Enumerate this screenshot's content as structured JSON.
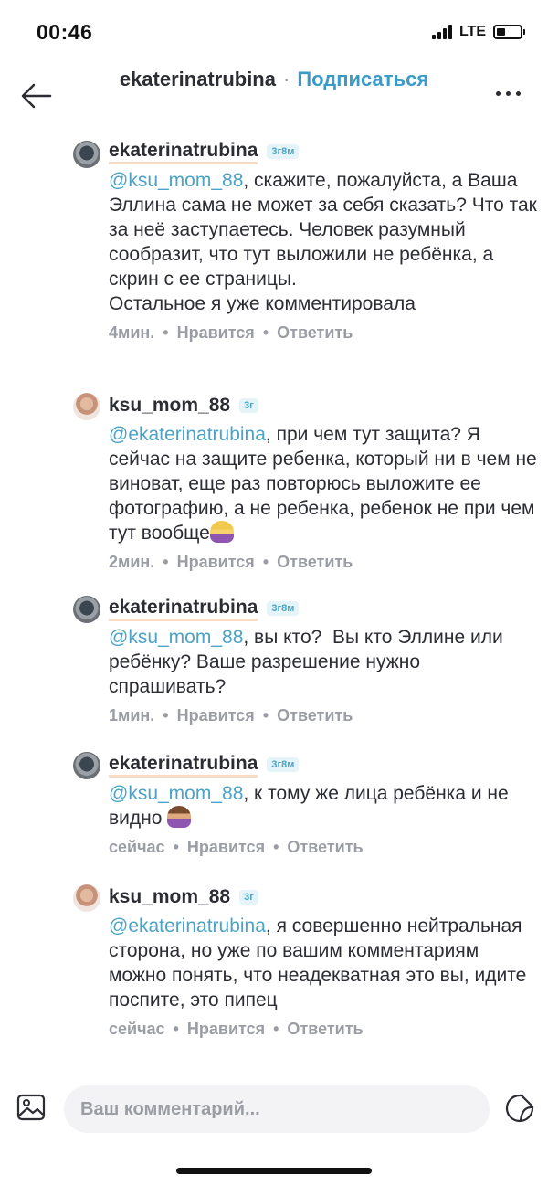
{
  "status_bar": {
    "time": "00:46",
    "network": "LTE"
  },
  "nav": {
    "username": "ekaterinatrubina",
    "separator": "·",
    "subscribe_label": "Подписаться",
    "back_icon": "arrow-left-icon",
    "more_icon": "more-horizontal-icon"
  },
  "comments": [
    {
      "username": "ekaterinatrubina",
      "badge": "3г8м",
      "mention": "@ksu_mom_88",
      "text": ", скажите, пожалуйста, а Ваша Эллина сама не может за себя сказать? Что так за неё заступаетесь. Человек разумный сообразит, что тут выложили не ребёнка, а скрин с ее страницы.\nОстальное я уже комментировала",
      "time": "4мин.",
      "like_label": "Нравится",
      "reply_label": "Ответить"
    },
    {
      "username": "ksu_mom_88",
      "badge": "3г",
      "mention": "@ekaterinatrubina",
      "text": ", при чем тут защита? Я сейчас на защите ребенка, который ни в чем не виноват, еще раз повторюсь выложите ее фотографию, а не ребенка, ребенок не при чем тут вообще",
      "emoji": "woman-tipping-hand-emoji",
      "time": "2мин.",
      "like_label": "Нравится",
      "reply_label": "Ответить"
    },
    {
      "username": "ekaterinatrubina",
      "badge": "3г8м",
      "mention": "@ksu_mom_88",
      "text": ", вы кто?  Вы кто Эллине или ребёнку? Ваше разрешение нужно спрашивать?",
      "time": "1мин.",
      "like_label": "Нравится",
      "reply_label": "Ответить"
    },
    {
      "username": "ekaterinatrubina",
      "badge": "3г8м",
      "mention": "@ksu_mom_88",
      "text": ", к тому же лица ребёнка и не видно ",
      "emoji": "woman-emoji",
      "time": "сейчас",
      "like_label": "Нравится",
      "reply_label": "Ответить"
    },
    {
      "username": "ksu_mom_88",
      "badge": "3г",
      "mention": "@ekaterinatrubina",
      "text": ", я совершенно нейтральная сторона, но уже по вашим комментариям можно понять, что неадекватная это вы, идите поспите, это пипец",
      "time": "сейчас",
      "like_label": "Нравится",
      "reply_label": "Ответить"
    }
  ],
  "meta_separator": "•",
  "input": {
    "placeholder": "Ваш комментарий..."
  },
  "colors": {
    "mention": "#4ba3c7",
    "subscribe": "#3b9bc7",
    "meta": "#9a9da4"
  }
}
